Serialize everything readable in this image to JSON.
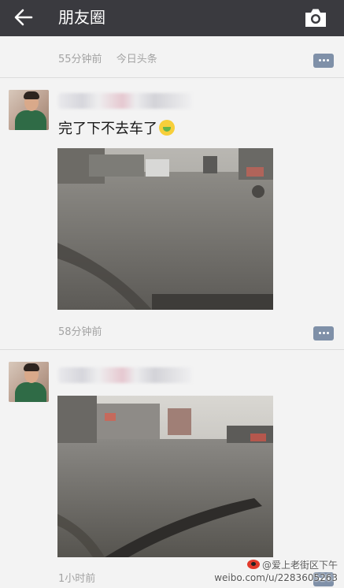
{
  "header": {
    "title": "朋友圈",
    "back_icon": "back-arrow-icon",
    "camera_icon": "camera-icon"
  },
  "prev_post": {
    "time": "55分钟前",
    "source": "今日头条"
  },
  "posts": [
    {
      "text": "完了下不去车了",
      "emoji": "crying-face-emoji",
      "time": "58分钟前"
    },
    {
      "time": "1小时前"
    }
  ],
  "watermark": {
    "handle": "@爱上老街区下午",
    "url": "weibo.com/u/2283605263"
  },
  "colors": {
    "topbar": "#3a3a3f",
    "comment_button": "#7f90a8",
    "meta_text": "#a3a3a3"
  }
}
